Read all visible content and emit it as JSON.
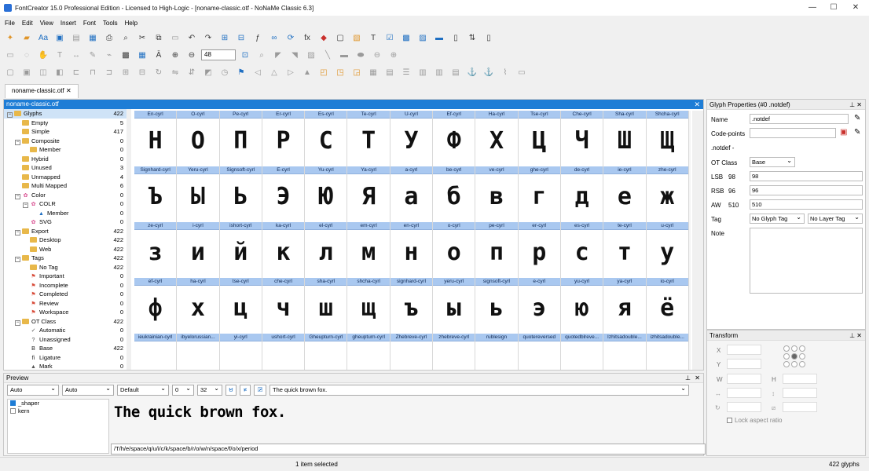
{
  "window": {
    "title": "FontCreator 15.0 Professional Edition - Licensed to High-Logic - [noname-classic.otf - NoNaMe Classic 6.3]"
  },
  "menu": [
    "File",
    "Edit",
    "View",
    "Insert",
    "Font",
    "Tools",
    "Help"
  ],
  "toolbar": {
    "zoom": "48"
  },
  "doc_tab": "noname-classic.otf",
  "glyph_panel": {
    "title": "noname-classic.otf"
  },
  "tree": [
    {
      "label": "Glyphs",
      "count": "422",
      "level": 0,
      "icon": "folder",
      "expand": "−",
      "selected": true
    },
    {
      "label": "Empty",
      "count": "5",
      "level": 1,
      "icon": "folder"
    },
    {
      "label": "Simple",
      "count": "417",
      "level": 1,
      "icon": "folder"
    },
    {
      "label": "Composite",
      "count": "0",
      "level": 1,
      "icon": "folder",
      "expand": "−"
    },
    {
      "label": "Member",
      "count": "0",
      "level": 2,
      "icon": "folder"
    },
    {
      "label": "Hybrid",
      "count": "0",
      "level": 1,
      "icon": "folder"
    },
    {
      "label": "Unused",
      "count": "3",
      "level": 1,
      "icon": "folder"
    },
    {
      "label": "Unmapped",
      "count": "4",
      "level": 1,
      "icon": "folder"
    },
    {
      "label": "Multi Mapped",
      "count": "6",
      "level": 1,
      "icon": "folder"
    },
    {
      "label": "Color",
      "count": "0",
      "level": 1,
      "icon": "color",
      "expand": "−"
    },
    {
      "label": "COLR",
      "count": "0",
      "level": 2,
      "icon": "color",
      "expand": "−"
    },
    {
      "label": "Member",
      "count": "0",
      "level": 3,
      "icon": "triangle"
    },
    {
      "label": "SVG",
      "count": "0",
      "level": 2,
      "icon": "color"
    },
    {
      "label": "Export",
      "count": "422",
      "level": 1,
      "icon": "folder",
      "expand": "−"
    },
    {
      "label": "Desktop",
      "count": "422",
      "level": 2,
      "icon": "folder"
    },
    {
      "label": "Web",
      "count": "422",
      "level": 2,
      "icon": "folder"
    },
    {
      "label": "Tags",
      "count": "422",
      "level": 1,
      "icon": "folder",
      "expand": "−"
    },
    {
      "label": "No Tag",
      "count": "422",
      "level": 2,
      "icon": "folder"
    },
    {
      "label": "Important",
      "count": "0",
      "level": 2,
      "icon": "flag"
    },
    {
      "label": "Incomplete",
      "count": "0",
      "level": 2,
      "icon": "flag"
    },
    {
      "label": "Completed",
      "count": "0",
      "level": 2,
      "icon": "flag"
    },
    {
      "label": "Review",
      "count": "0",
      "level": 2,
      "icon": "flag"
    },
    {
      "label": "Workspace",
      "count": "0",
      "level": 2,
      "icon": "flag"
    },
    {
      "label": "OT Class",
      "count": "422",
      "level": 1,
      "icon": "folder",
      "expand": "−"
    },
    {
      "label": "Automatic",
      "count": "0",
      "level": 2,
      "icon": "check"
    },
    {
      "label": "Unassigned",
      "count": "0",
      "level": 2,
      "icon": "question"
    },
    {
      "label": "Base",
      "count": "422",
      "level": 2,
      "icon": "B"
    },
    {
      "label": "Ligature",
      "count": "0",
      "level": 2,
      "icon": "fi"
    },
    {
      "label": "Mark",
      "count": "0",
      "level": 2,
      "icon": "mark"
    }
  ],
  "glyphs": [
    {
      "name": "En-cyrl",
      "char": "Н"
    },
    {
      "name": "O-cyrl",
      "char": "О"
    },
    {
      "name": "Pe-cyrl",
      "char": "П"
    },
    {
      "name": "Er-cyrl",
      "char": "Р"
    },
    {
      "name": "Es-cyrl",
      "char": "С"
    },
    {
      "name": "Te-cyrl",
      "char": "Т"
    },
    {
      "name": "U-cyrl",
      "char": "У"
    },
    {
      "name": "Ef-cyrl",
      "char": "Ф"
    },
    {
      "name": "Ha-cyrl",
      "char": "Х"
    },
    {
      "name": "Tse-cyrl",
      "char": "Ц"
    },
    {
      "name": "Che-cyrl",
      "char": "Ч"
    },
    {
      "name": "Sha-cyrl",
      "char": "Ш"
    },
    {
      "name": "Shcha-cyrl",
      "char": "Щ"
    },
    {
      "name": "Signhard-cyrl",
      "char": "Ъ"
    },
    {
      "name": "Yeru-cyrl",
      "char": "Ы"
    },
    {
      "name": "Signsoft-cyrl",
      "char": "Ь"
    },
    {
      "name": "E-cyrl",
      "char": "Э"
    },
    {
      "name": "Yu-cyrl",
      "char": "Ю"
    },
    {
      "name": "Ya-cyrl",
      "char": "Я"
    },
    {
      "name": "a-cyrl",
      "char": "а"
    },
    {
      "name": "be-cyrl",
      "char": "б"
    },
    {
      "name": "ve-cyrl",
      "char": "в"
    },
    {
      "name": "ghe-cyrl",
      "char": "г"
    },
    {
      "name": "de-cyrl",
      "char": "д"
    },
    {
      "name": "ie-cyrl",
      "char": "е"
    },
    {
      "name": "zhe-cyrl",
      "char": "ж"
    },
    {
      "name": "ze-cyrl",
      "char": "з"
    },
    {
      "name": "i-cyrl",
      "char": "и"
    },
    {
      "name": "ishort-cyrl",
      "char": "й"
    },
    {
      "name": "ka-cyrl",
      "char": "к"
    },
    {
      "name": "el-cyrl",
      "char": "л"
    },
    {
      "name": "em-cyrl",
      "char": "м"
    },
    {
      "name": "en-cyrl",
      "char": "н"
    },
    {
      "name": "o-cyrl",
      "char": "о"
    },
    {
      "name": "pe-cyrl",
      "char": "п"
    },
    {
      "name": "er-cyrl",
      "char": "р"
    },
    {
      "name": "es-cyrl",
      "char": "с"
    },
    {
      "name": "te-cyrl",
      "char": "т"
    },
    {
      "name": "u-cyrl",
      "char": "у"
    },
    {
      "name": "ef-cyrl",
      "char": "ф"
    },
    {
      "name": "ha-cyrl",
      "char": "х"
    },
    {
      "name": "tse-cyrl",
      "char": "ц"
    },
    {
      "name": "che-cyrl",
      "char": "ч"
    },
    {
      "name": "sha-cyrl",
      "char": "ш"
    },
    {
      "name": "shcha-cyrl",
      "char": "щ"
    },
    {
      "name": "signhard-cyrl",
      "char": "ъ"
    },
    {
      "name": "yeru-cyrl",
      "char": "ы"
    },
    {
      "name": "signsoft-cyrl",
      "char": "ь"
    },
    {
      "name": "e-cyrl",
      "char": "э"
    },
    {
      "name": "yu-cyrl",
      "char": "ю"
    },
    {
      "name": "ya-cyrl",
      "char": "я"
    },
    {
      "name": "io-cyrl",
      "char": "ё"
    },
    {
      "name": "ieukrainian-cyrl",
      "char": ""
    },
    {
      "name": "ibyelorussian...",
      "char": ""
    },
    {
      "name": "yi-cyrl",
      "char": ""
    },
    {
      "name": "ushort-cyrl",
      "char": ""
    },
    {
      "name": "Gheupturn-cyrl",
      "char": ""
    },
    {
      "name": "gheupturn-cyrl",
      "char": ""
    },
    {
      "name": "Zhebreve-cyrl",
      "char": ""
    },
    {
      "name": "zhebreve-cyrl",
      "char": ""
    },
    {
      "name": "rublesign",
      "char": ""
    },
    {
      "name": "quotereversed",
      "char": ""
    },
    {
      "name": "quotedblreve...",
      "char": ""
    },
    {
      "name": "Izhitsadouble...",
      "char": ""
    },
    {
      "name": "izhitsadouble...",
      "char": ""
    }
  ],
  "preview": {
    "title": "Preview",
    "script": "Auto",
    "language": "Auto",
    "features_mode": "Default",
    "spacing": "0",
    "size": "32",
    "underline_label": "U",
    "text": "The quick brown fox.",
    "sample": "The quick brown fox.",
    "glyph_path": "/T/h/e/space/q/u/i/c/k/space/b/r/o/w/n/space/f/o/x/period",
    "features": [
      {
        "label": "_shaper",
        "checked": true
      },
      {
        "label": "kern",
        "checked": false
      }
    ]
  },
  "glyph_properties": {
    "title": "Glyph Properties (#0 .notdef)",
    "name_label": "Name",
    "name_value": ".notdef",
    "codepoints_label": "Code-points",
    "codepoints_value": "",
    "glyph_line": ".notdef -",
    "otclass_label": "OT Class",
    "otclass_value": "Base",
    "lsb_label": "LSB",
    "lsb_num": "98",
    "lsb_value": "98",
    "rsb_label": "RSB",
    "rsb_num": "96",
    "rsb_value": "96",
    "aw_label": "AW",
    "aw_num": "510",
    "aw_value": "510",
    "tag_label": "Tag",
    "glyph_tag": "No Glyph Tag",
    "layer_tag": "No Layer Tag",
    "note_label": "Note"
  },
  "transform": {
    "title": "Transform",
    "x_label": "X",
    "y_label": "Y",
    "w_label": "W",
    "h_label": "H",
    "lock_label": "Lock aspect ratio"
  },
  "status": {
    "selection": "1 item selected",
    "count": "422 glyphs"
  }
}
